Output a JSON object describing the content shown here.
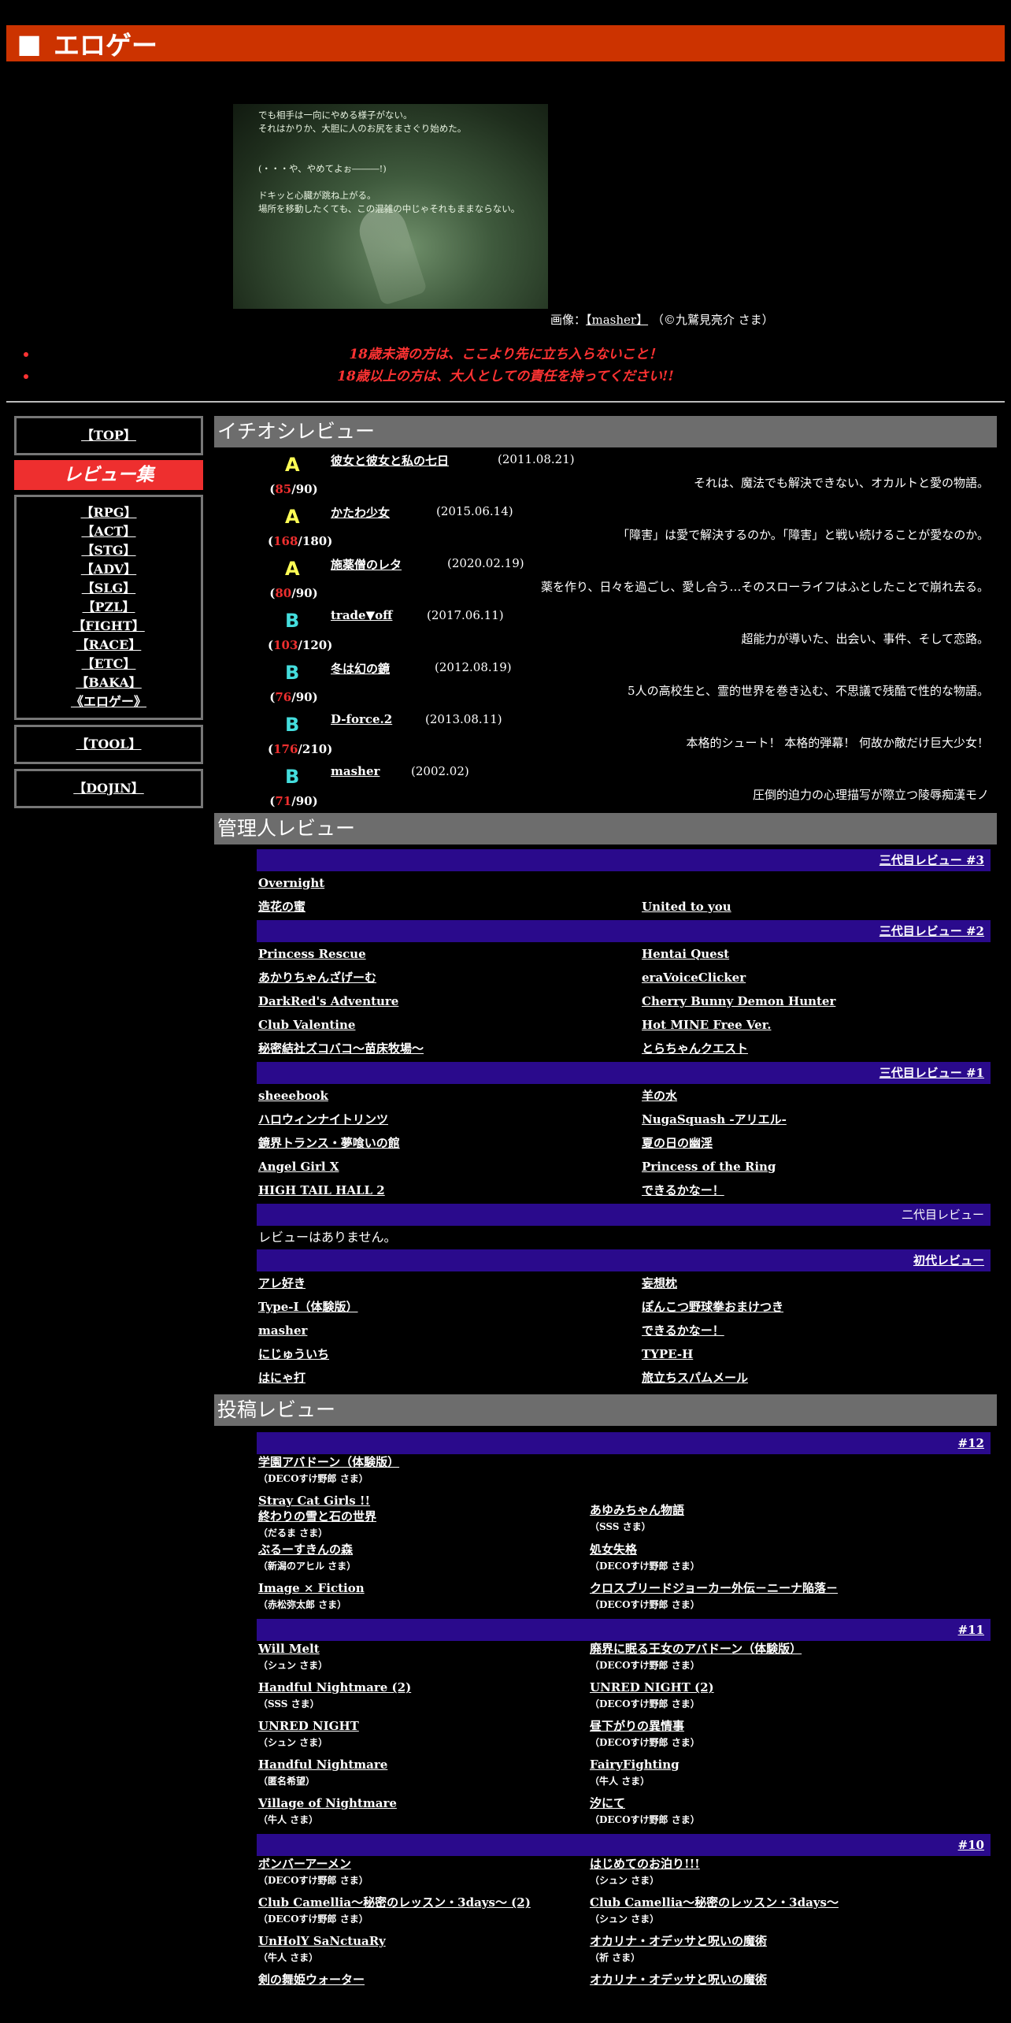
{
  "title": "エロゲー",
  "title_icon": "square-icon",
  "hero": {
    "lines": [
      "でも相手は一向にやめる様子がない。",
      "それはかりか、大胆に人のお尻をまさぐり始めた。",
      "",
      "",
      "(・・・や、やめてよぉ―――!)",
      "",
      "ドキッと心臓が跳ね上がる。",
      "場所を移動したくても、この混雑の中じゃそれもままならない。"
    ]
  },
  "caption": {
    "prefix": "画像：",
    "link": "【masher】",
    "suffix": "（©九鷲見亮介 さま）"
  },
  "warnings": [
    "18歳未満の方は、ここより先に立ち入らないこと！",
    "18歳以上の方は、大人としての責任を持ってください!!"
  ],
  "sidebar": {
    "top": "【TOP】",
    "review_head": "レビュー集",
    "categories": [
      "【RPG】",
      "【ACT】",
      "【STG】",
      "【ADV】",
      "【SLG】",
      "【PZL】",
      "【FIGHT】",
      "【RACE】",
      "【ETC】",
      "【BAKA】",
      "《エロゲー》"
    ],
    "tool": "【TOOL】",
    "dojin": "【DOJIN】"
  },
  "sections": {
    "pick": "イチオシレビュー",
    "admin": "管理人レビュー",
    "posted": "投稿レビュー"
  },
  "picks": [
    {
      "grade": "A",
      "color": "#ffff55",
      "score": "85",
      "total": "90",
      "name": "彼女と彼女と私の七日",
      "date": "(2011.08.21)",
      "desc": "それは、魔法でも解決できない、オカルトと愛の物語。"
    },
    {
      "grade": "A",
      "color": "#ffff55",
      "score": "168",
      "total": "180",
      "name": "かたわ少女",
      "date": "(2015.06.14)",
      "desc": "「障害」は愛で解決するのか。「障害」と戦い続けることが愛なのか。"
    },
    {
      "grade": "A",
      "color": "#ffff55",
      "score": "80",
      "total": "90",
      "name": "施薬僧のレタ",
      "date": "(2020.02.19)",
      "desc": "薬を作り、日々を過ごし、愛し合う…そのスローライフはふとしたことで崩れ去る。"
    },
    {
      "grade": "B",
      "color": "#44dddd",
      "score": "103",
      "total": "120",
      "name": "trade▼off",
      "date": "(2017.06.11)",
      "desc": "超能力が導いた、出会い、事件、そして恋路。"
    },
    {
      "grade": "B",
      "color": "#44dddd",
      "score": "76",
      "total": "90",
      "name": "冬は幻の鏡",
      "date": "(2012.08.19)",
      "desc": "5人の高校生と、霊的世界を巻き込む、不思議で残酷で性的な物語。"
    },
    {
      "grade": "B",
      "color": "#44dddd",
      "score": "176",
      "total": "210",
      "name": "D-force.2",
      "date": "(2013.08.11)",
      "desc": "本格的シュート！ 本格的弾幕！ 何故か敵だけ巨大少女！"
    },
    {
      "grade": "B",
      "color": "#44dddd",
      "score": "71",
      "total": "90",
      "name": "masher",
      "date": "(2002.02)",
      "desc": "圧倒的迫力の心理描写が際立つ陵辱痴漢モノ"
    }
  ],
  "admin_groups": [
    {
      "label": "三代目レビュー #3",
      "link": true,
      "items": [
        "Overnight",
        "",
        "造花の蜜",
        "United to you"
      ]
    },
    {
      "label": "三代目レビュー #2",
      "link": true,
      "items": [
        "Princess Rescue",
        "Hentai Quest",
        "あかりちゃんざげーむ",
        "eraVoiceClicker",
        "DarkRed's Adventure",
        "Cherry Bunny Demon Hunter",
        "Club Valentine",
        "Hot MINE Free Ver.",
        "秘密結社ズコバコ～苗床牧場～",
        "とらちゃんクエスト"
      ]
    },
    {
      "label": "三代目レビュー #1",
      "link": true,
      "items": [
        "sheeebook",
        "羊の水",
        "ハロウィンナイトリンツ",
        "NugaSquash -アリエル-",
        "鏡界トランス・夢喰いの館",
        "夏の日の幽淫",
        "Angel Girl X",
        "Princess of the Ring",
        "HIGH TAIL HALL 2",
        "できるかなー！"
      ]
    },
    {
      "label": "二代目レビュー",
      "link": false,
      "none": "レビューはありません。",
      "items": []
    },
    {
      "label": "初代レビュー",
      "link": true,
      "items": [
        "アレ好き",
        "妄想枕",
        "Type-I（体験版）",
        "ぽんこつ野球拳おまけつき",
        "masher",
        "できるかなー！",
        "にじゅういち",
        "TYPE-H",
        "はにゃ打",
        "旅立ちスパムメール"
      ]
    }
  ],
  "posted_groups": [
    {
      "label": "#12",
      "rows": [
        [
          {
            "titles": [
              "学園アバドーン（体験版）"
            ],
            "author": "（DECOすけ野郎 さま）"
          },
          null
        ],
        [
          {
            "titles": [
              "Stray Cat Girls !!",
              "終わりの雪と石の世界"
            ],
            "author": "（だるま さま）"
          },
          {
            "titles": [
              "あゆみちゃん物語"
            ],
            "author": "（SSS さま）"
          }
        ],
        [
          {
            "titles": [
              "ぶるーすきんの森"
            ],
            "author": "（新潟のアヒル さま）"
          },
          {
            "titles": [
              "処女失格"
            ],
            "author": "（DECOすけ野郎 さま）"
          }
        ],
        [
          {
            "titles": [
              "Image × Fiction"
            ],
            "author": "（赤松弥太郎 さま）"
          },
          {
            "titles": [
              "クロスブリードジョーカー外伝－ニーナ陥落－"
            ],
            "author": "（DECOすけ野郎 さま）"
          }
        ]
      ]
    },
    {
      "label": "#11",
      "rows": [
        [
          {
            "titles": [
              "Will Melt"
            ],
            "author": "（シュン さま）"
          },
          {
            "titles": [
              "廃界に眠る王女のアバドーン（体験版）"
            ],
            "author": "（DECOすけ野郎 さま）"
          }
        ],
        [
          {
            "titles": [
              "Handful Nightmare (2)"
            ],
            "author": "（SSS さま）"
          },
          {
            "titles": [
              "UNRED NIGHT (2)"
            ],
            "author": "（DECOすけ野郎 さま）"
          }
        ],
        [
          {
            "titles": [
              "UNRED NIGHT"
            ],
            "author": "（シュン さま）"
          },
          {
            "titles": [
              "昼下がりの異情事"
            ],
            "author": "（DECOすけ野郎 さま）"
          }
        ],
        [
          {
            "titles": [
              "Handful Nightmare"
            ],
            "author": "（匿名希望）"
          },
          {
            "titles": [
              "FairyFighting"
            ],
            "author": "（牛人 さま）"
          }
        ],
        [
          {
            "titles": [
              "Village of Nightmare"
            ],
            "author": "（牛人 さま）"
          },
          {
            "titles": [
              "汐にて"
            ],
            "author": "（DECOすけ野郎 さま）"
          }
        ]
      ]
    },
    {
      "label": "#10",
      "rows": [
        [
          {
            "titles": [
              "ボンバーアーメン"
            ],
            "author": "（DECOすけ野郎 さま）"
          },
          {
            "titles": [
              "はじめてのお泊り!!!"
            ],
            "author": "（シュン さま）"
          }
        ],
        [
          {
            "titles": [
              "Club Camellia～秘密のレッスン・3days～ (2)"
            ],
            "author": "（DECOすけ野郎 さま）"
          },
          {
            "titles": [
              "Club Camellia～秘密のレッスン・3days～"
            ],
            "author": "（シュン さま）"
          }
        ],
        [
          {
            "titles": [
              "UnHolY SaNctuaRy"
            ],
            "author": "（牛人 さま）"
          },
          {
            "titles": [
              "オカリナ・オデッサと呪いの魔術"
            ],
            "author": "（祈 さま）"
          }
        ],
        [
          {
            "titles": [
              "剣の舞姫ウォーター"
            ],
            "author": ""
          },
          {
            "titles": [
              "オカリナ・オデッサと呪いの魔術"
            ],
            "author": ""
          }
        ]
      ]
    }
  ]
}
